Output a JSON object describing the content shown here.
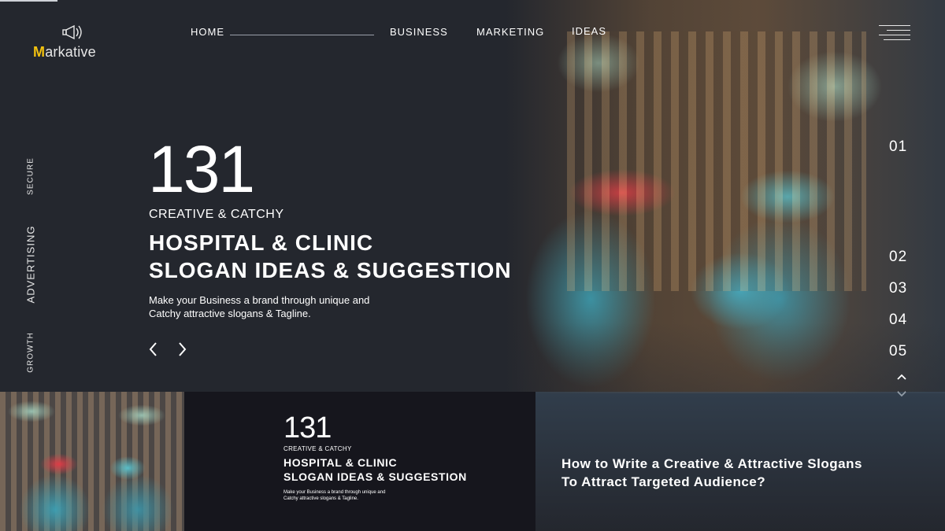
{
  "brand": {
    "logo_text_first": "M",
    "logo_text_rest": "arkative",
    "logo_icon": "megaphone-icon"
  },
  "nav": {
    "items": [
      {
        "label": "HOME"
      },
      {
        "label": "BUSINESS"
      },
      {
        "label": "MARKETING"
      },
      {
        "label": "IDEAS"
      }
    ],
    "menu_icon": "hamburger-menu-icon"
  },
  "side_words": [
    "SECURE",
    "ADVERTISING",
    "GROWTH"
  ],
  "hero": {
    "number": "131",
    "kicker": "CREATIVE & CATCHY",
    "headline_line1": "HOSPITAL & CLINIC",
    "headline_line2": "SLOGAN IDEAS & SUGGESTION",
    "description_line1": "Make your Business a brand through unique and",
    "description_line2": "Catchy attractive slogans & Tagline.",
    "prev_icon": "chevron-left-icon",
    "next_icon": "chevron-right-icon"
  },
  "slides": {
    "numbers": [
      "01",
      "02",
      "03",
      "04",
      "05"
    ],
    "up_icon": "chevron-up-icon",
    "down_icon": "chevron-down-icon"
  },
  "card": {
    "number": "131",
    "kicker": "CREATIVE & CATCHY",
    "headline_line1": "HOSPITAL & CLINIC",
    "headline_line2": "SLOGAN IDEAS & SUGGESTION",
    "description_line1": "Make your Business a brand through unique and",
    "description_line2": "Catchy attractive slogans & Tagline."
  },
  "article": {
    "title_line1": "How to Write a Creative & Attractive Slogans",
    "title_line2": "To Attract Targeted Audience?"
  },
  "colors": {
    "background": "#24272e",
    "accent_logo": "#f3c20f",
    "card": "#16161d",
    "text": "#ffffff"
  }
}
